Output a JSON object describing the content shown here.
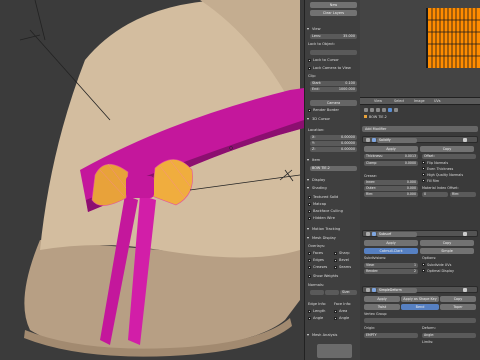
{
  "npanel": {
    "top_buttons": [
      "New",
      "Clear Layers"
    ],
    "view_head": "View",
    "lens_label": "Lens:",
    "lens_value": "35.000",
    "lock_object": "Lock to Object:",
    "lock_cursor": "Lock to Cursor",
    "lock_camera": "Lock Camera to View",
    "clip_head": "Clip:",
    "clip_start_label": "Start:",
    "clip_start_value": "0.100",
    "clip_end_label": "End:",
    "clip_end_value": "1000.000",
    "camera_btn": "Camera",
    "render_border": "Render Border",
    "cursor_head": "3D Cursor",
    "location_label": "Location:",
    "x_label": "X:",
    "x_value": "0.00000",
    "y_label": "Y:",
    "y_value": "0.00000",
    "z_label": "Z:",
    "z_value": "0.00000",
    "item_head": "Item",
    "item_name": "BOW TIE.2",
    "display_head": "Display",
    "shading_head": "Shading",
    "textured_solid": "Textured Solid",
    "matcap": "Matcap",
    "backface": "Backface Culling",
    "hidden_wire": "Hidden Wire",
    "motion_head": "Motion Tracking",
    "mesh_display_head": "Mesh Display",
    "overlays_label": "Overlays:",
    "overlays": [
      [
        "Faces",
        "Sharp"
      ],
      [
        "Edges",
        "Bevel"
      ],
      [
        "Creases",
        "Seams"
      ]
    ],
    "show_weights": "Show Weights",
    "normals_label": "Normals:",
    "size_label": "Size:",
    "edge_info_label": "Edge Info:",
    "face_info_label": "Face Info:",
    "edge_info": [
      [
        "Length",
        "Area"
      ],
      [
        "Angle",
        "Angle"
      ]
    ],
    "mesh_analysis": "Mesh Analysis"
  },
  "uv_header": {
    "items": [
      "View",
      "Select",
      "Image",
      "UVs"
    ]
  },
  "props": {
    "object_name": "BOW TIE.2",
    "add_modifier": "Add Modifier",
    "solidify": {
      "name": "Solidify",
      "apply": "Apply",
      "copy": "Copy",
      "thickness_label": "Thickness:",
      "thickness_value": "0.0013",
      "clamp_label": "Clamp:",
      "clamp_value": "0.0000",
      "offset_label": "Offset:",
      "offset_value": "-1.00",
      "flip_normals": "Flip Normals",
      "even_thickness": "Even Thickness",
      "high_quality": "High Quality Normals",
      "fill_rim": "Fill Rim",
      "crease_label": "Crease:",
      "inner_label": "Inner:",
      "inner_value": "0.000",
      "outer_label": "Outer:",
      "outer_value": "0.000",
      "rim_label": "Rim:",
      "rim_value": "0.000",
      "material_index_offset": "Material Index Offset:",
      "mat_value": "0",
      "rim_mat": "Rim:"
    },
    "subsurf": {
      "name": "Subsurf",
      "apply": "Apply",
      "copy": "Copy",
      "catmull": "Catmull-Clark",
      "simple": "Simple",
      "subdivisions": "Subdivisions:",
      "view_label": "View:",
      "view_value": "1",
      "render_label": "Render:",
      "render_value": "2",
      "options": "Options:",
      "subdivide_uvs": "Subdivide UVs",
      "optimal_display": "Optimal Display"
    },
    "simpledeform": {
      "name": "SimpleDeform",
      "apply": "Apply",
      "apply_shape": "Apply as Shape Key",
      "copy": "Copy",
      "modes": [
        "Twist",
        "Bend",
        "Taper"
      ],
      "vertex_group": "Vertex Group:",
      "origin_label": "Origin:",
      "origin_value": "EMPTY",
      "deform_label": "Deform:",
      "deform_value": "Angle:",
      "limits_label": "Limits:"
    }
  },
  "colors": {
    "hat": "#cfb89a",
    "ribbon": "#c4179c",
    "bow": "#e8a23a",
    "uv_orange": "#ff8c00",
    "blue_button": "#5680c2"
  }
}
